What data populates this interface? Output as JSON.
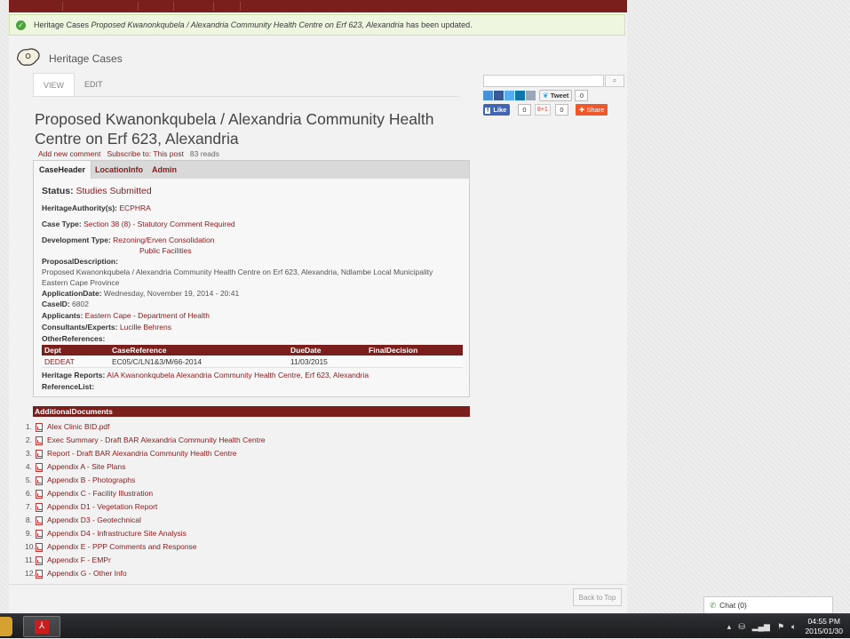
{
  "status_message": {
    "prefix": "Heritage Cases ",
    "node_title": "Proposed Kwanonkqubela / Alexandria Community Health Centre on Erf 623, Alexandria",
    "suffix": " has been updated."
  },
  "site": {
    "name": "Heritage Cases"
  },
  "primary_tabs": [
    {
      "label": "VIEW"
    },
    {
      "label": "EDIT"
    }
  ],
  "node": {
    "title": "Proposed Kwanonkqubela / Alexandria Community Health Centre on Erf 623, Alexandria",
    "add_comment": "Add new comment",
    "subscribe": "Subscribe to: This post",
    "reads": "83 reads"
  },
  "case_tabs": [
    {
      "label": "CaseHeader"
    },
    {
      "label": "LocationInfo"
    },
    {
      "label": "Admin"
    }
  ],
  "case": {
    "status_label": "Status:",
    "status_value": "Studies Submitted",
    "authority_label": "HeritageAuthority(s):",
    "authority_value": "ECPHRA",
    "case_type_label": "Case Type:",
    "case_type_value": "Section 38 (8) - Statutory Comment Required",
    "dev_type_label": "Development Type:",
    "dev_type_values": [
      "Rezoning/Erven Consolidation",
      "Public Facilities"
    ],
    "proposal_label": "ProposalDescription:",
    "proposal_text": "Proposed Kwanonkqubela / Alexandria Community Health Centre on Erf 623, Alexandria, Ndlambe Local Municipality",
    "province": "Eastern Cape Province",
    "app_date_label": "ApplicationDate:",
    "app_date_value": "Wednesday, November 19, 2014 - 20:41",
    "case_id_label": "CaseID:",
    "case_id_value": "6802",
    "applicants_label": "Applicants:",
    "applicants_value": "Eastern Cape - Department of Health",
    "consultants_label": "Consultants/Experts:",
    "consultants_value": "Lucille Behrens",
    "other_refs_label": "OtherReferences:",
    "references_table": {
      "headers": [
        "Dept",
        "CaseReference",
        "DueDate",
        "FinalDecision"
      ],
      "rows": [
        {
          "dept": "DEDEAT",
          "case_ref": "EC05/C/LN1&3/M/66-2014",
          "due_date": "11/03/2015",
          "final_decision": ""
        }
      ]
    },
    "heritage_reports_label": "Heritage Reports:",
    "heritage_reports_value": "AIA Kwanonkqubela Alexandria Community Health Centre, Erf 623, Alexandria",
    "reference_list_label": "ReferenceList:"
  },
  "additional_documents": {
    "header": "AdditionalDocuments",
    "items": [
      {
        "n": "1.",
        "label": "Alex Clinic BID.pdf"
      },
      {
        "n": "2.",
        "label": "Exec Summary - Draft BAR Alexandria Community Health Centre"
      },
      {
        "n": "3.",
        "label": "Report - Draft BAR Alexandria Community Health Centre"
      },
      {
        "n": "4.",
        "label": "Appendix A - Site Plans"
      },
      {
        "n": "5.",
        "label": "Appendix B - Photographs"
      },
      {
        "n": "6.",
        "label": "Appendix C - Facility Illustration"
      },
      {
        "n": "7.",
        "label": "Appendix D1 - Vegetation Report"
      },
      {
        "n": "8.",
        "label": "Appendix D3 - Geotechnical"
      },
      {
        "n": "9.",
        "label": "Appendix D4 - Infrastructure Site Analysis"
      },
      {
        "n": "10.",
        "label": "Appendix E - PPP Comments and Response"
      },
      {
        "n": "11.",
        "label": "Appendix F - EMPr"
      },
      {
        "n": "12.",
        "label": "Appendix G - Other Info"
      }
    ]
  },
  "sidebar": {
    "search_placeholder": "",
    "tweet_label": "Tweet",
    "tweet_count": "0",
    "like_label": "Like",
    "like_count": "0",
    "gplus_label": "8+1",
    "gplus_count": "0",
    "share_label": "Share"
  },
  "back_to_top": "Back to Top",
  "chat": {
    "label": "Chat (0)"
  },
  "taskbar": {
    "time": "04:55 PM",
    "date": "2015/01/30"
  },
  "colors": {
    "accent": "#7b1f1c",
    "link": "#8b1a1a",
    "success_bg": "#eef6df"
  },
  "icons": {
    "status": "check-circle-icon",
    "logo": "south-africa-map-icon",
    "search": "magnifier-icon",
    "document": "pdf-file-icon"
  }
}
